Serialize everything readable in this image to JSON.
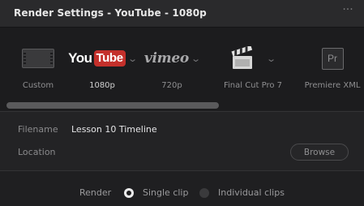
{
  "window": {
    "title": "Render Settings - YouTube - 1080p",
    "more_glyph": "···"
  },
  "presets": [
    {
      "label": "Custom",
      "icon": "film-strip-icon",
      "selected": false
    },
    {
      "label": "1080p",
      "icon": "youtube-logo",
      "selected": true,
      "logo_you": "You",
      "logo_tube": "Tube"
    },
    {
      "label": "720p",
      "icon": "vimeo-logo",
      "selected": false,
      "logo_text": "vimeo"
    },
    {
      "label": "Final Cut Pro 7",
      "icon": "clapperboard-icon",
      "selected": false
    },
    {
      "label": "Premiere XML",
      "icon": "premiere-pro-icon",
      "selected": false,
      "logo_text": "Pr"
    }
  ],
  "caret": "⌄",
  "file": {
    "filename_label": "Filename",
    "filename_value": "Lesson 10 Timeline",
    "location_label": "Location",
    "location_value": "",
    "browse_label": "Browse"
  },
  "render": {
    "label": "Render",
    "options": [
      {
        "label": "Single clip",
        "checked": true
      },
      {
        "label": "Individual clips",
        "checked": false
      }
    ]
  },
  "colors": {
    "youtube_red": "#c4302b",
    "panel_bg": "#1f1f21"
  }
}
